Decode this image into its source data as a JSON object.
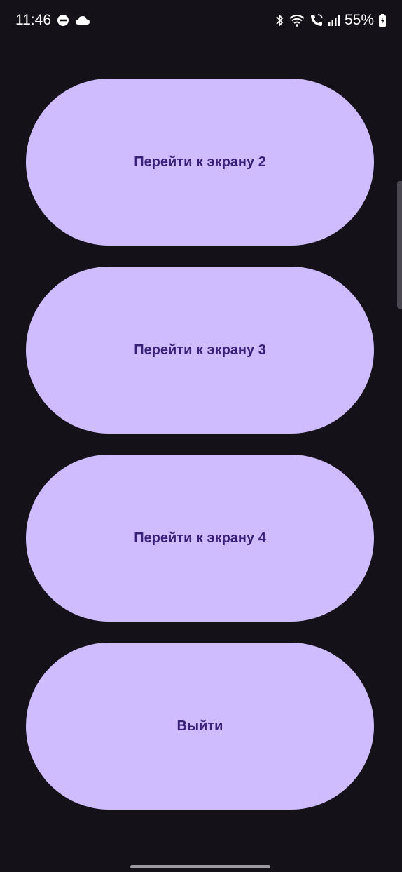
{
  "status_bar": {
    "time": "11:46",
    "battery_percent": "55%",
    "icons_left": [
      "do-not-disturb-icon",
      "cloud-icon"
    ],
    "icons_right": [
      "bluetooth-icon",
      "wifi-icon",
      "wifi-call-icon",
      "signal-icon",
      "battery-icon"
    ]
  },
  "buttons": [
    {
      "label": "Перейти к экрану 2"
    },
    {
      "label": "Перейти к экрану 3"
    },
    {
      "label": "Перейти к экрану 4"
    },
    {
      "label": "Выйти"
    }
  ],
  "colors": {
    "background": "#141218",
    "button_bg": "#cfbcff",
    "button_text": "#3a1f78"
  }
}
